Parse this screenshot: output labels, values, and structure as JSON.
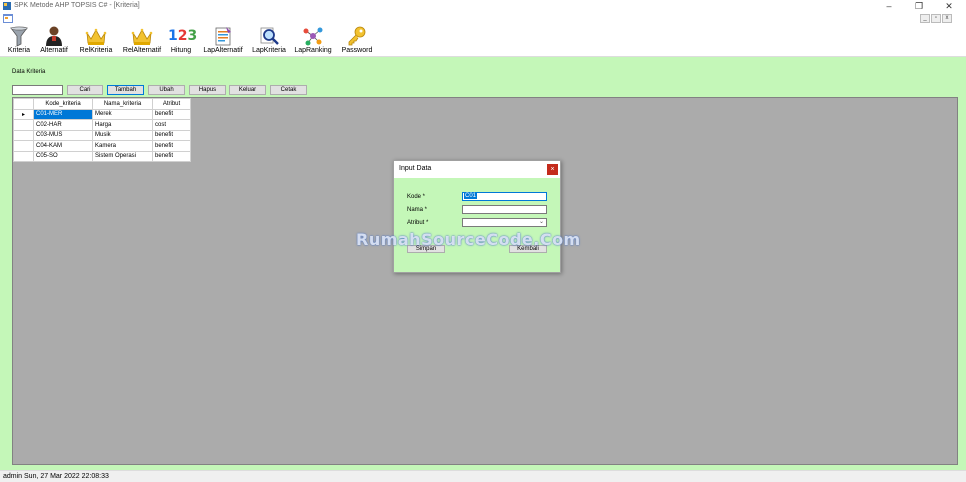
{
  "window": {
    "title": "SPK Metode AHP TOPSIS C# - [Kriteria]"
  },
  "toolbar": {
    "items": [
      {
        "label": "Kriteria",
        "icon": "filter-icon"
      },
      {
        "label": "Alternatif",
        "icon": "user-icon"
      },
      {
        "label": "RelKriteria",
        "icon": "crown-icon"
      },
      {
        "label": "RelAlternatif",
        "icon": "crown-icon"
      },
      {
        "label": "Hitung",
        "icon": "numbers-icon",
        "glyph": "123"
      },
      {
        "label": "LapAlternatif",
        "icon": "report-icon"
      },
      {
        "label": "LapKriteria",
        "icon": "magnifier-icon"
      },
      {
        "label": "LapRanking",
        "icon": "network-icon"
      },
      {
        "label": "Password",
        "icon": "key-icon"
      }
    ]
  },
  "form": {
    "title": "Data Kriteria",
    "buttons": {
      "cari": "Cari",
      "tambah": "Tambah",
      "ubah": "Ubah",
      "hapus": "Hapus",
      "keluar": "Keluar",
      "cetak": "Cetak"
    }
  },
  "grid": {
    "columns": [
      "Kode_kriteria",
      "Nama_kriteria",
      "Atribut"
    ],
    "rows": [
      [
        "C01-MER",
        "Merek",
        "benefit"
      ],
      [
        "C02-HAR",
        "Harga",
        "cost"
      ],
      [
        "C03-MUS",
        "Musik",
        "benefit"
      ],
      [
        "C04-KAM",
        "Kamera",
        "benefit"
      ],
      [
        "C05-SO",
        "Sistem Operasi",
        "benefit"
      ]
    ],
    "row_indicator": "▸"
  },
  "dialog": {
    "title": "Input Data",
    "close": "×",
    "labels": {
      "kode": "Kode *",
      "nama": "Nama *",
      "atribut": "Atribut *"
    },
    "values": {
      "kode": "C01",
      "nama": "",
      "atribut": ""
    },
    "buttons": {
      "simpan": "Simpan",
      "kembali": "Kembali"
    }
  },
  "watermark": "RumahSourceCode.Com",
  "statusbar": {
    "text": "admin Sun, 27 Mar 2022 22:08:33"
  },
  "colors": {
    "client_bg": "#c4f7b8",
    "grid_bg": "#ababab",
    "selection": "#0078d7"
  }
}
